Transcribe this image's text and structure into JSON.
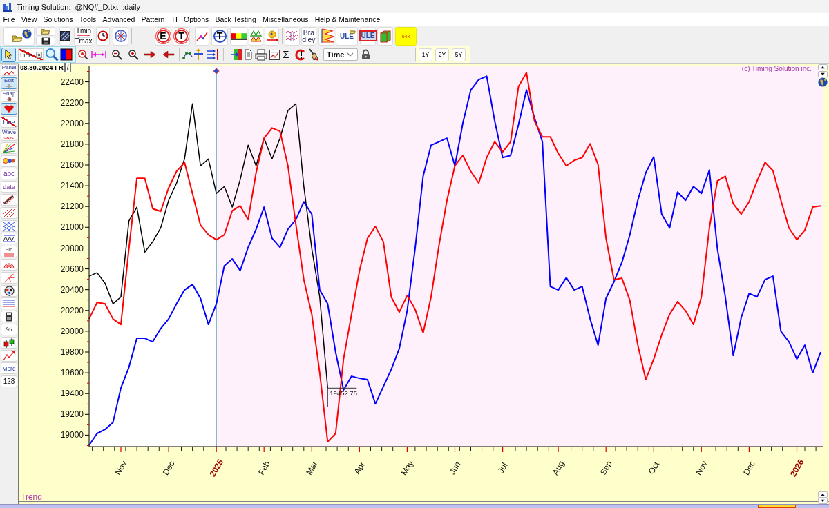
{
  "window": {
    "title": "Timing Solution:  @NQ#_D.txt  :daily"
  },
  "menu": [
    "File",
    "View",
    "Solutions",
    "Tools",
    "Advanced",
    "Pattern",
    "TI",
    "Options",
    "Back Testing",
    "Miscellaneous",
    "Help & Maintenance"
  ],
  "toolbar_1": {
    "tmin_tmax": [
      "Tmin",
      "Tmax"
    ],
    "letters": [
      {
        "kind": "swirl",
        "label": "E"
      },
      {
        "kind": "swirl",
        "label": "T"
      },
      {
        "kind": "globe",
        "label": "T"
      }
    ],
    "bradley": [
      "Bra",
      "dley"
    ],
    "ule_buttons": [
      "ULE",
      "ULE"
    ],
    "speed_button": "64x"
  },
  "toolbar_2": {
    "pointer_tool": {
      "selected": true
    },
    "line_tool": {
      "label": "Line"
    },
    "sum_button": "Σ",
    "time_select": {
      "value": "Time"
    },
    "range_buttons": [
      "1Y",
      "2Y",
      "5Y"
    ]
  },
  "side_toolbar": [
    {
      "kind": "labeled",
      "label": "Panel",
      "selected": false
    },
    {
      "kind": "labeled",
      "label": "Edit",
      "selected": true
    },
    {
      "kind": "labeled",
      "label": "Snap",
      "selected": false
    },
    {
      "kind": "icon",
      "selected": true
    },
    {
      "kind": "struck",
      "label": "Line",
      "selected": false
    },
    {
      "kind": "labeled",
      "label": "Wave",
      "selected": false
    },
    {
      "kind": "icon",
      "selected": false
    },
    {
      "kind": "icon",
      "selected": false
    },
    {
      "kind": "text",
      "label": "abc",
      "selected": false
    },
    {
      "kind": "text",
      "label": "date",
      "selected": false
    },
    {
      "kind": "icon",
      "selected": false
    },
    {
      "kind": "icon",
      "selected": false
    },
    {
      "kind": "icon",
      "selected": false
    },
    {
      "kind": "icon",
      "selected": false
    },
    {
      "kind": "labeled",
      "label": "Fib",
      "selected": false
    },
    {
      "kind": "icon",
      "selected": false
    },
    {
      "kind": "icon",
      "selected": false
    },
    {
      "kind": "icon",
      "selected": false
    },
    {
      "kind": "icon",
      "selected": false
    },
    {
      "kind": "icon",
      "selected": false
    },
    {
      "kind": "text",
      "label": "%",
      "selected": false
    },
    {
      "kind": "icon",
      "selected": false
    },
    {
      "kind": "icon",
      "selected": false
    },
    {
      "kind": "text",
      "label": "More",
      "selected": false
    },
    {
      "kind": "text",
      "label": "128",
      "selected": false
    }
  ],
  "chart": {
    "date_label": "08.30.2024 FR",
    "date_button": "t",
    "copyright": "(c) Timing Solution inc.",
    "chart_data": {
      "type": "line",
      "ylim": [
        18890,
        22550
      ],
      "categories": [
        null,
        null,
        null,
        null,
        "Nov",
        null,
        null,
        null,
        null,
        null,
        "Dec",
        null,
        null,
        null,
        null,
        null,
        "2025",
        null,
        null,
        null,
        null,
        null,
        "Feb",
        null,
        null,
        null,
        null,
        null,
        "Mar",
        null,
        null,
        null,
        null,
        null,
        "Apr",
        null,
        null,
        null,
        null,
        null,
        "May",
        null,
        null,
        null,
        null,
        null,
        "Jun",
        null,
        null,
        null,
        null,
        null,
        "Jul",
        null,
        null,
        null,
        null,
        null,
        null,
        "Aug",
        null,
        null,
        null,
        null,
        null,
        "Sep",
        null,
        null,
        null,
        null,
        null,
        "Oct",
        null,
        null,
        null,
        null,
        null,
        "Nov",
        null,
        null,
        null,
        null,
        null,
        "Dec",
        null,
        null,
        null,
        null,
        null,
        "2026",
        null,
        null,
        null
      ],
      "yticks": [
        19000,
        19200,
        19400,
        19600,
        19800,
        20000,
        20200,
        20400,
        20600,
        20800,
        21000,
        21200,
        21400,
        21600,
        21800,
        22000,
        22200,
        22400
      ],
      "series": [
        {
          "color": "#000000",
          "values": [
            20530,
            20563,
            20463,
            20264,
            20330,
            21061,
            21194,
            20762,
            20862,
            20995,
            21260,
            21426,
            21658,
            22189,
            21592,
            21658,
            21326,
            21393,
            21194,
            21459,
            21791,
            21592,
            21858,
            21658,
            21858,
            22124,
            22189,
            21393,
            20795,
            20330,
            19453,
            null,
            null,
            null,
            null,
            null,
            null,
            null,
            null,
            null,
            null,
            null,
            null,
            null,
            null,
            null,
            null,
            null,
            null,
            null,
            null,
            null,
            null,
            null,
            null,
            null,
            null,
            null,
            null,
            null,
            null,
            null,
            null,
            null,
            null,
            null,
            null,
            null,
            null,
            null,
            null,
            null,
            null,
            null,
            null,
            null,
            null,
            null,
            null,
            null,
            null,
            null,
            null,
            null,
            null,
            null,
            null,
            null,
            null,
            null,
            null,
            null,
            null
          ]
        },
        {
          "color": "#0000ff",
          "values": [
            18903,
            19016,
            19055,
            19122,
            19454,
            19653,
            19932,
            19932,
            19899,
            20025,
            20118,
            20264,
            20397,
            20450,
            20317,
            20065,
            20264,
            20629,
            20696,
            20583,
            20808,
            20981,
            21194,
            20895,
            20808,
            20981,
            21074,
            21247,
            21127,
            20397,
            20264,
            19799,
            19434,
            19567,
            19547,
            19534,
            19301,
            19467,
            19633,
            19832,
            20198,
            20795,
            21492,
            21791,
            21824,
            21858,
            21592,
            22004,
            22322,
            22422,
            22455,
            22024,
            21672,
            21692,
            21990,
            22322,
            22057,
            21824,
            20430,
            20397,
            20516,
            20397,
            20430,
            20118,
            19866,
            20317,
            20476,
            20662,
            20928,
            21260,
            21526,
            21678,
            21127,
            20994,
            21340,
            21260,
            21393,
            21326,
            21552,
            20795,
            20330,
            19766,
            20131,
            20364,
            20330,
            20496,
            20530,
            19998,
            19899,
            19733,
            19866,
            19600,
            19799
          ]
        },
        {
          "color": "#ff0000",
          "values": [
            20118,
            20277,
            20264,
            20118,
            20065,
            20795,
            21472,
            21472,
            21180,
            21154,
            21379,
            21539,
            21625,
            21326,
            21021,
            20928,
            20881,
            20928,
            21160,
            21207,
            21074,
            21526,
            21858,
            21957,
            21924,
            21592,
            21028,
            20496,
            20164,
            19600,
            18936,
            19016,
            19733,
            20164,
            20583,
            20895,
            21008,
            20862,
            20330,
            20184,
            20344,
            20211,
            19985,
            20330,
            20828,
            21260,
            21592,
            21692,
            21539,
            21426,
            21672,
            21824,
            21725,
            21824,
            22356,
            22488,
            22024,
            21871,
            21871,
            21711,
            21592,
            21645,
            21672,
            21804,
            21605,
            20895,
            20496,
            20510,
            20297,
            19866,
            19534,
            19733,
            19965,
            20164,
            20284,
            20198,
            20065,
            20330,
            20994,
            21446,
            21492,
            21227,
            21127,
            21247,
            21446,
            21625,
            21545,
            21260,
            20994,
            20881,
            20974,
            21194,
            21207
          ]
        }
      ],
      "ref_lines": [
        {
          "axis": "x",
          "value": "2025"
        }
      ],
      "annotations": [
        {
          "y": 19452.75,
          "text": "19452.75"
        }
      ]
    }
  },
  "bottom_panel": {
    "label": "Trend"
  }
}
